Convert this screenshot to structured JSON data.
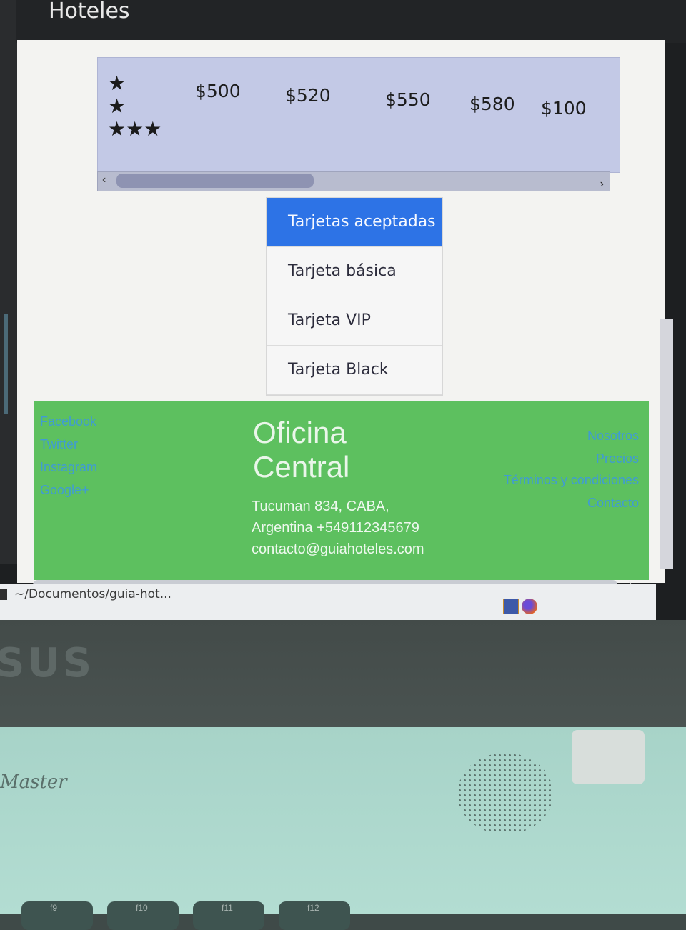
{
  "header": {
    "brand": "Hoteles"
  },
  "price_table": {
    "stars_rows": [
      "★",
      "★",
      "★★★"
    ],
    "prices": [
      "$500",
      "$520",
      "$550",
      "$580",
      "$100"
    ]
  },
  "scroll": {
    "left_arrow": "‹",
    "right_arrow": "›"
  },
  "cards": {
    "title": "Tarjetas aceptadas",
    "items": [
      "Tarjeta básica",
      "Tarjeta VIP",
      "Tarjeta Black"
    ]
  },
  "footer": {
    "social": [
      "Facebook",
      "Twitter",
      "Instagram",
      "Google+"
    ],
    "office_title": "Oficina Central",
    "address": [
      "Tucuman 834, CABA,",
      "Argentina +549112345679",
      "contacto@guiahoteles.com"
    ],
    "links": [
      "Nosotros",
      "Precios",
      "Términos y condiciones",
      "Contacto"
    ]
  },
  "taskbar": {
    "window_title": "~/Documentos/guia-hot..."
  },
  "hardware": {
    "logo": "SUS",
    "brand": "Master",
    "keys": [
      "f9",
      "f10",
      "f11",
      "f12"
    ]
  },
  "colors": {
    "active_item": "#2d73e6",
    "footer_bg": "#5dc05f",
    "price_card": "#c3c9e6"
  }
}
